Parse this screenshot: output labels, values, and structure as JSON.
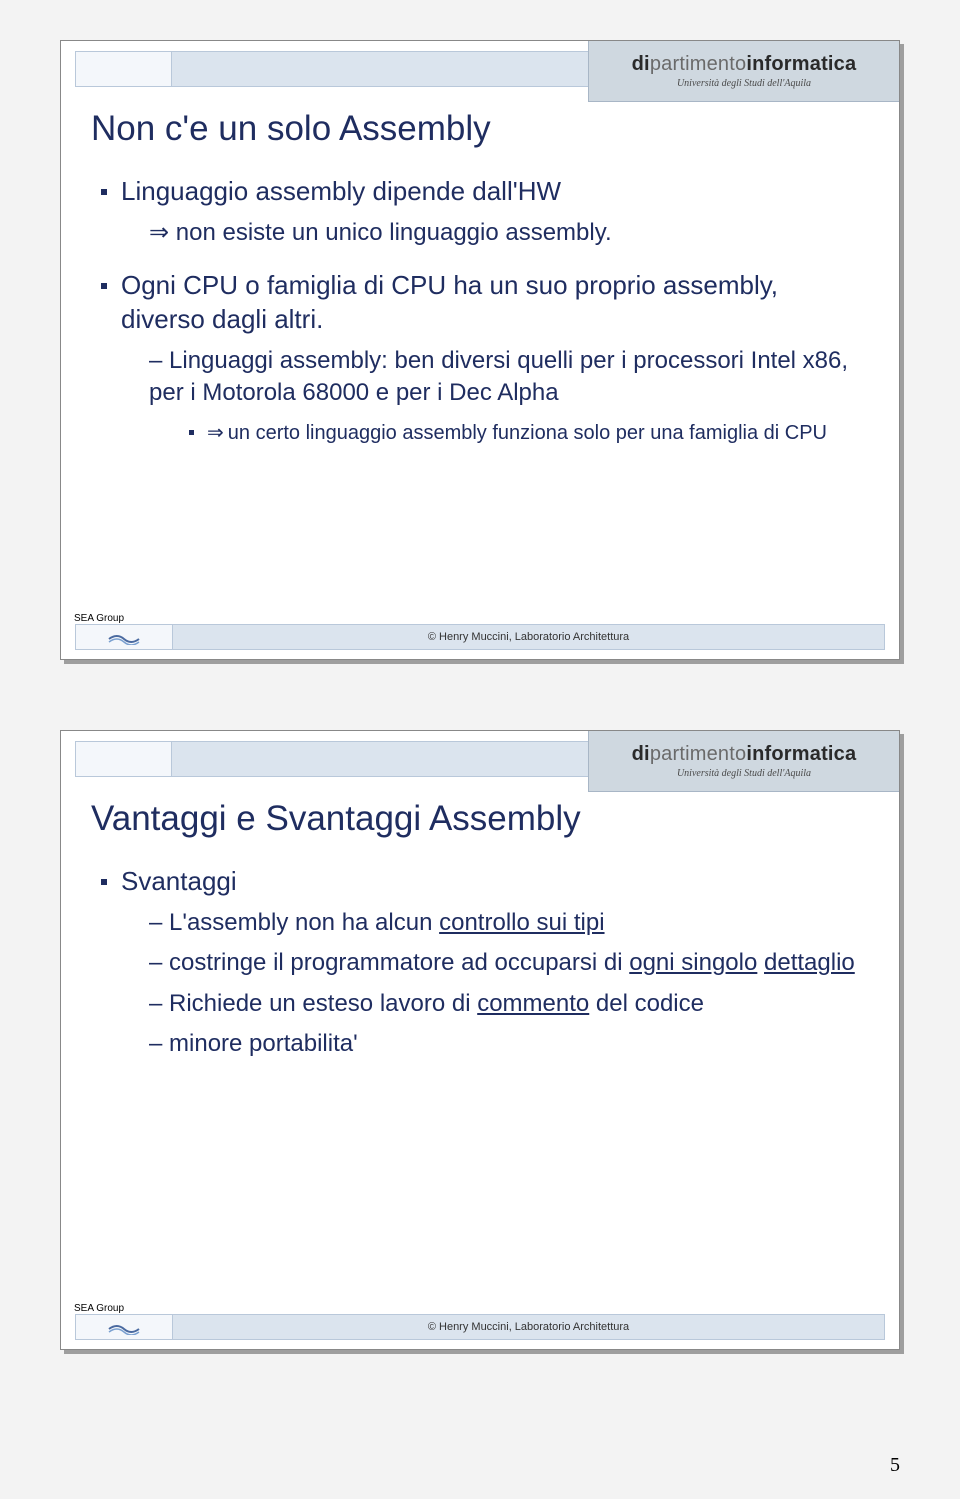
{
  "brand": {
    "prefix": "di",
    "bold1": "partimento",
    "bold2": "informatica",
    "sub": "Università degli Studi dell'Aquila"
  },
  "slide1": {
    "title": "Non c'e un solo Assembly",
    "b1": "Linguaggio assembly dipende dall'HW",
    "b1_sub1": "non esiste un unico linguaggio assembly.",
    "b2": "Ogni CPU o famiglia di CPU ha un suo proprio assembly, diverso dagli altri.",
    "b2_sub1": "Linguaggi assembly: ben diversi quelli per i processori Intel x86, per i Motorola 68000 e per i Dec Alpha",
    "b2_sub1_sub1_arrow": "⇒",
    "b2_sub1_sub1": "un certo linguaggio assembly funziona solo per una famiglia di CPU"
  },
  "slide2": {
    "title": "Vantaggi e Svantaggi Assembly",
    "b1": "Svantaggi",
    "s1_pre": "L'assembly non ha alcun ",
    "s1_u": "controllo sui tipi",
    "s2_pre": "costringe il programmatore ad occuparsi di ",
    "s2_u1": "ogni singolo",
    "s2_mid": " ",
    "s2_u2": "dettaglio",
    "s3_pre": "Richiede un esteso lavoro di ",
    "s3_u": "commento",
    "s3_post": " del codice",
    "s4": "minore portabilita'"
  },
  "footer": {
    "sea": "SEA Group",
    "credit": "© Henry Muccini, Laboratorio Architettura"
  },
  "page_number": "5"
}
